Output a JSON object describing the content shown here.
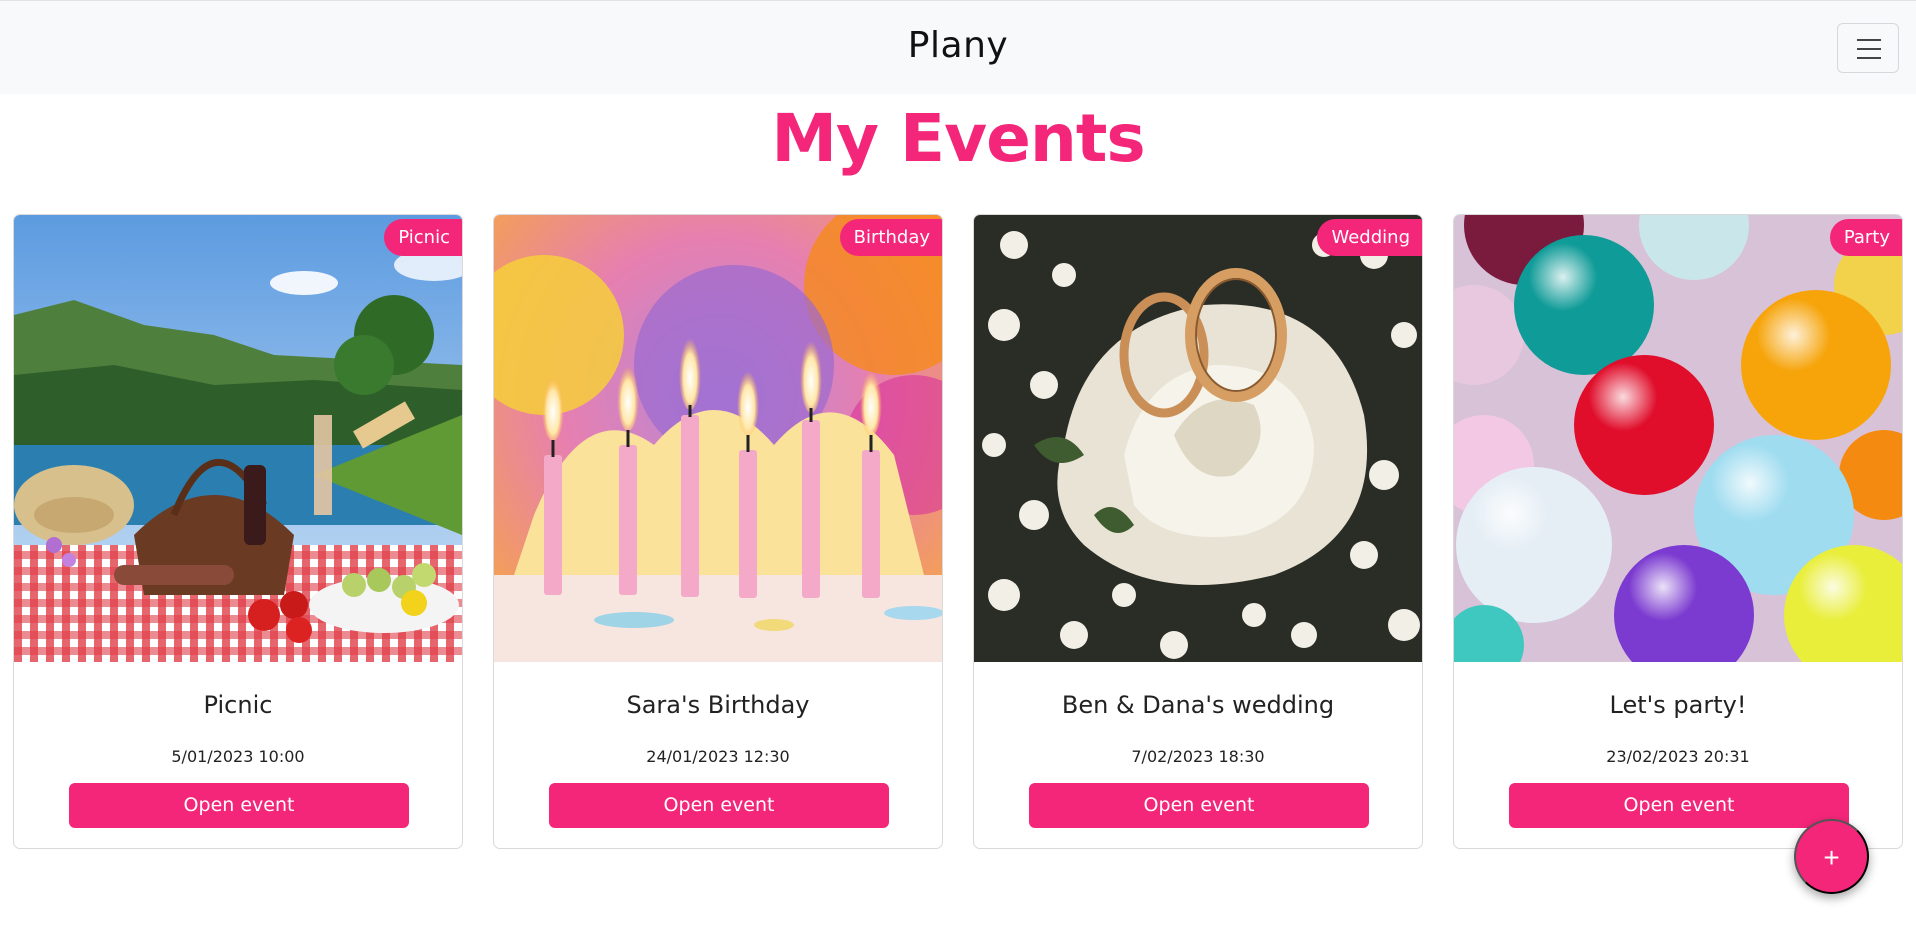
{
  "navbar": {
    "brand": "Plany",
    "menu_icon": "hamburger-menu-icon"
  },
  "page": {
    "title": "My Events"
  },
  "events": [
    {
      "badge": "Picnic",
      "title": "Picnic",
      "date": "5/01/2023 10:00",
      "button": "Open event",
      "image": "picnic-lakeside-photo"
    },
    {
      "badge": "Birthday",
      "title": "Sara's Birthday",
      "date": "24/01/2023 12:30",
      "button": "Open event",
      "image": "birthday-candles-photo"
    },
    {
      "badge": "Wedding",
      "title": "Ben & Dana's wedding",
      "date": "7/02/2023 18:30",
      "button": "Open event",
      "image": "wedding-rings-rose-photo"
    },
    {
      "badge": "Party",
      "title": "Let's party!",
      "date": "23/02/2023 20:31",
      "button": "Open event",
      "image": "party-balloons-photo"
    }
  ],
  "fab": {
    "label": "+",
    "icon": "plus-icon"
  },
  "colors": {
    "accent": "#f4267a",
    "navbar_bg": "#f8f9fa",
    "text": "#212529"
  }
}
